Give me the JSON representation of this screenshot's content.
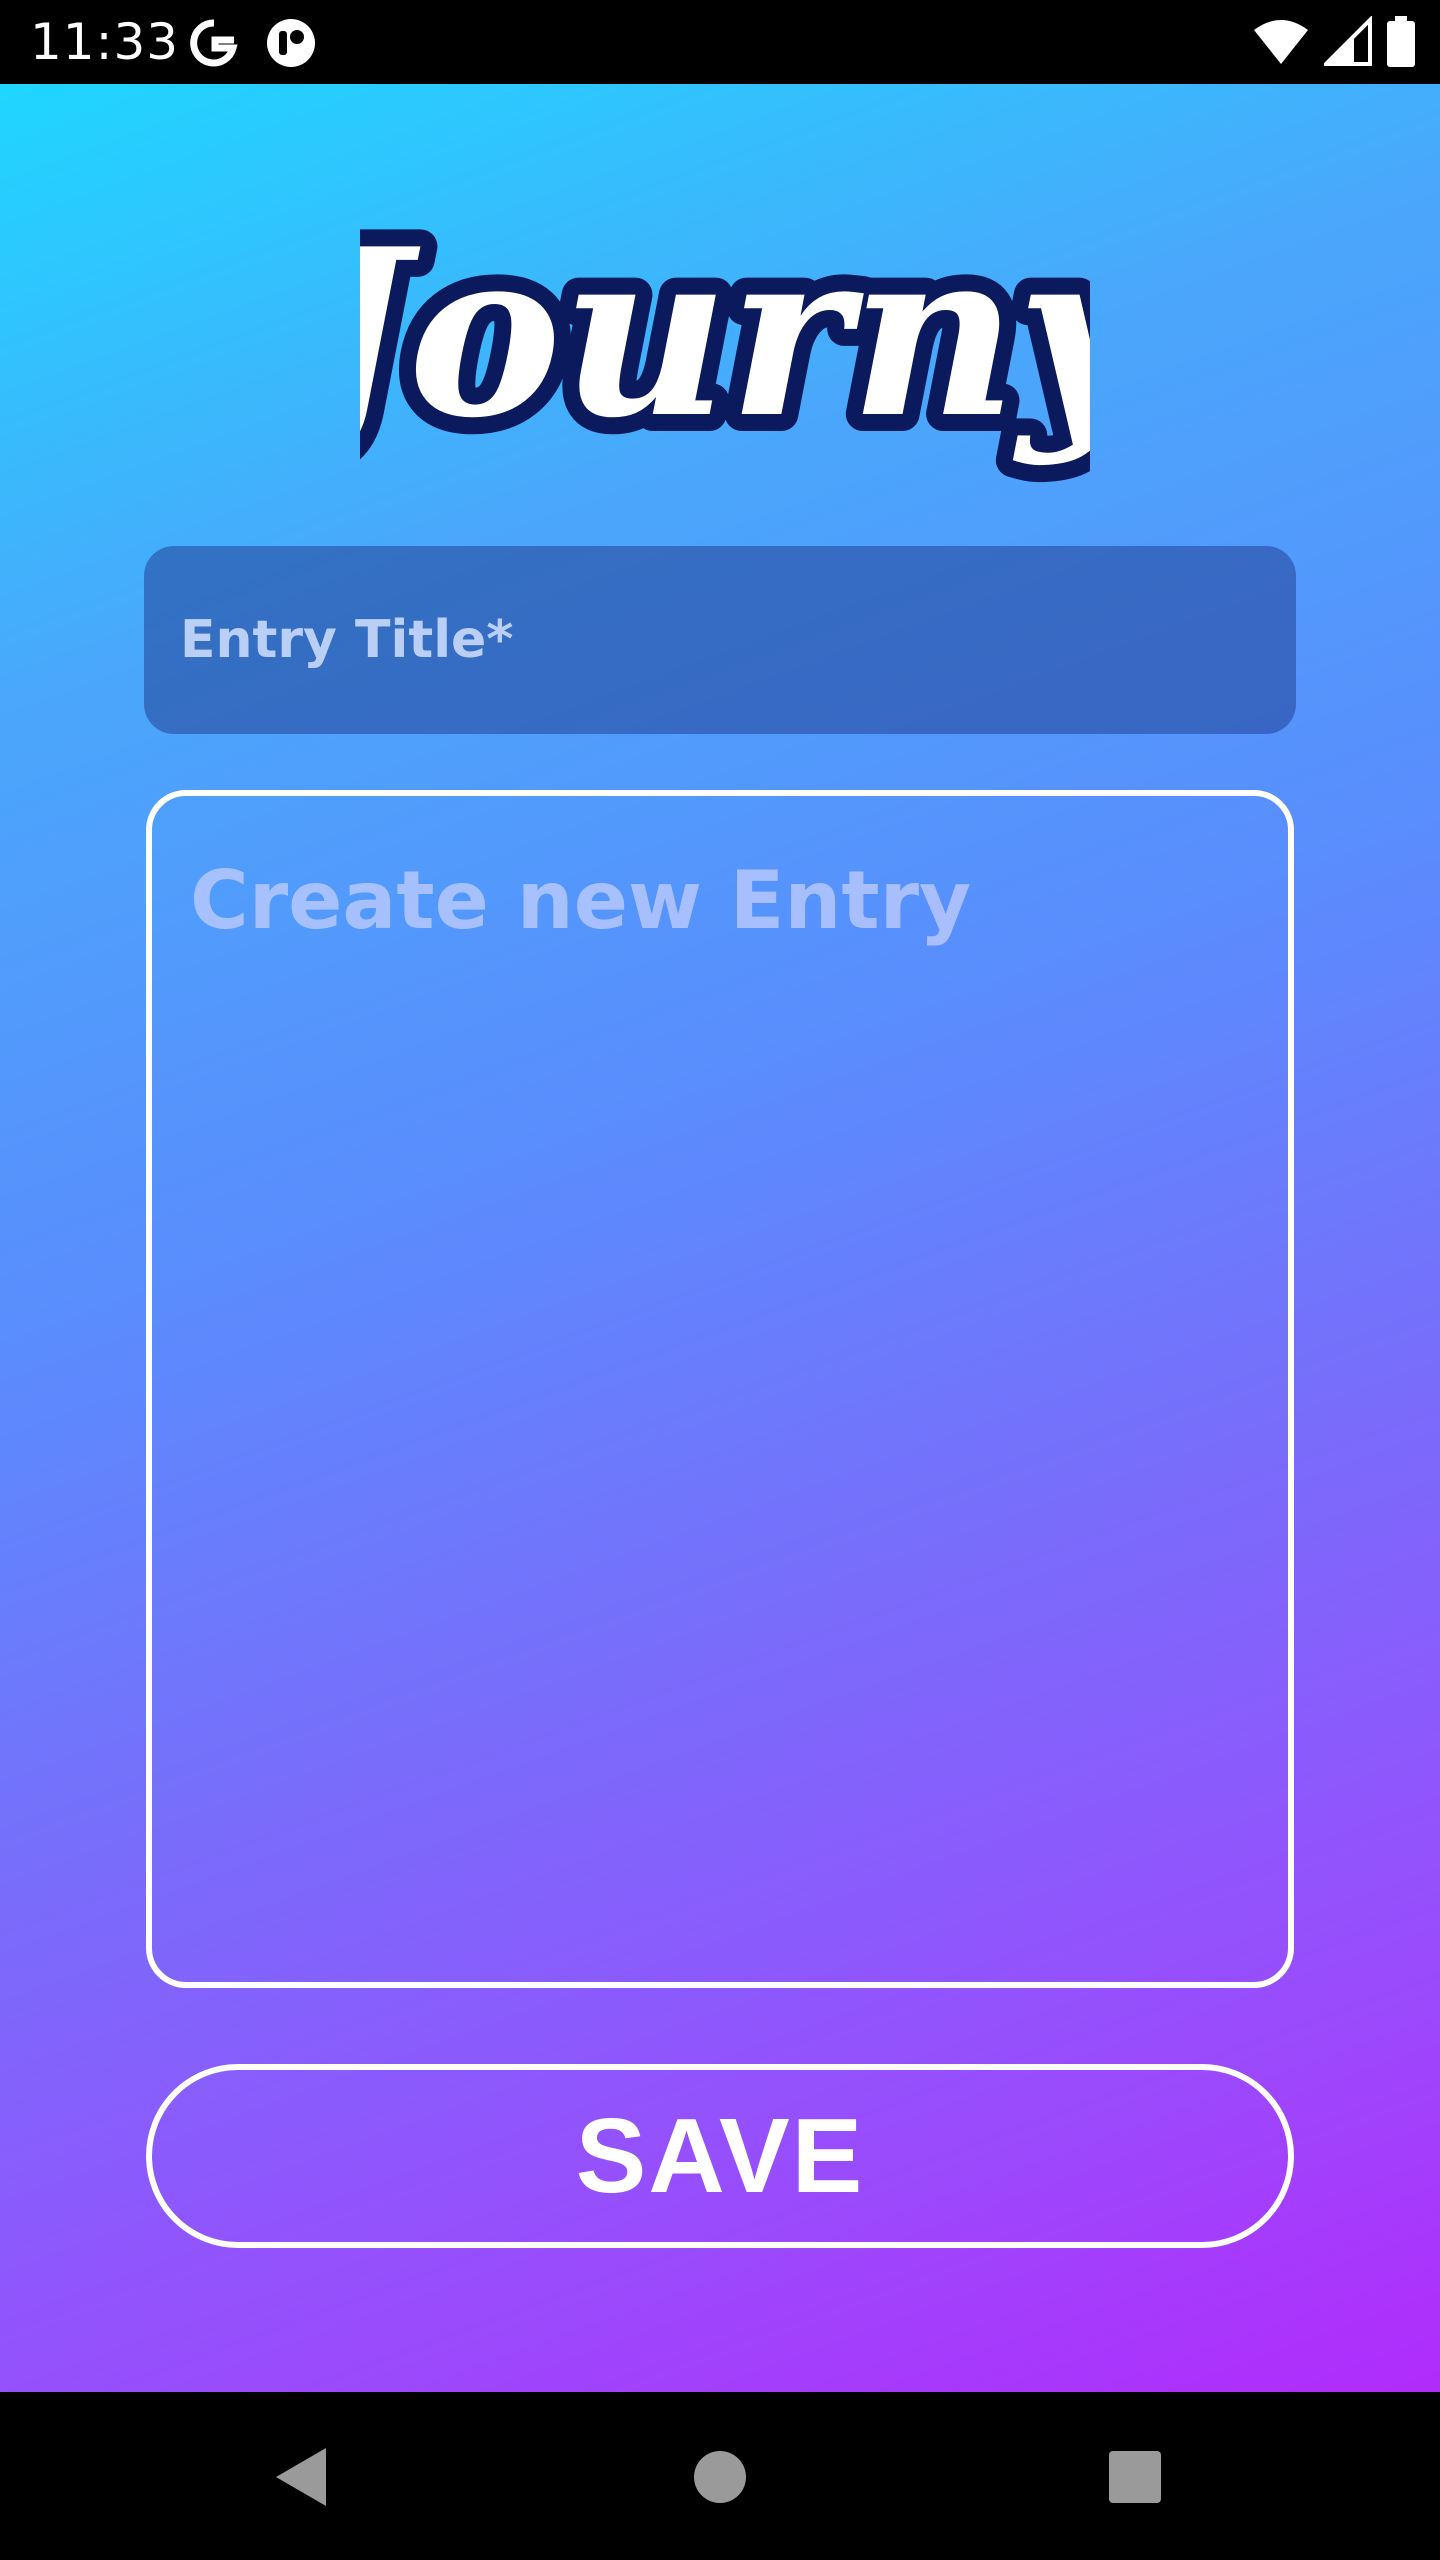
{
  "status_bar": {
    "time": "11:33",
    "icons": [
      "google-icon",
      "app-notification-icon",
      "wifi-icon",
      "cell-signal-icon",
      "battery-icon"
    ]
  },
  "app": {
    "logo_text": "Journy",
    "title_field": {
      "placeholder": "Entry Title*"
    },
    "entry_field": {
      "placeholder": "Create new Entry"
    },
    "save_label": "SAVE",
    "colors": {
      "gradient_top": "#1fd6ff",
      "gradient_bottom": "#b12bfb",
      "logo_outline": "#0a1a5c",
      "logo_fill": "#ffffff"
    }
  },
  "nav_bar": {
    "buttons": [
      "back-icon",
      "home-icon",
      "recents-icon"
    ]
  }
}
